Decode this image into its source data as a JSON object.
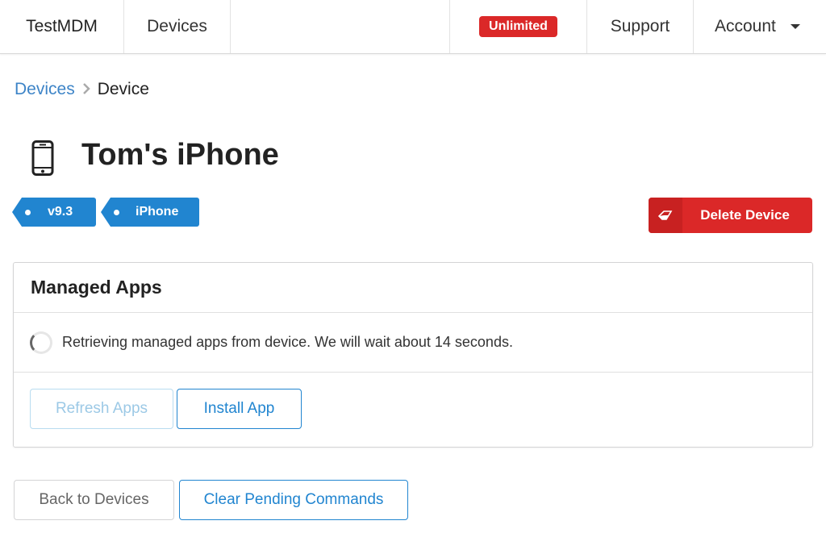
{
  "nav": {
    "brand": "TestMDM",
    "devices": "Devices",
    "plan_badge": "Unlimited",
    "support": "Support",
    "account": "Account"
  },
  "breadcrumb": {
    "parent": "Devices",
    "current": "Device"
  },
  "device": {
    "name": "Tom's iPhone",
    "icon": "phone-icon",
    "tags": [
      "v9.3",
      "iPhone"
    ]
  },
  "actions": {
    "delete_label": "Delete Device",
    "delete_icon": "eraser-icon"
  },
  "managed_apps": {
    "title": "Managed Apps",
    "status": "Retrieving managed apps from device. We will wait about 14 seconds.",
    "refresh_label": "Refresh Apps",
    "install_label": "Install App"
  },
  "footer": {
    "back_label": "Back to Devices",
    "clear_label": "Clear Pending Commands"
  },
  "colors": {
    "primary": "#2185d0",
    "danger": "#db2828",
    "link": "#3d84c7"
  }
}
